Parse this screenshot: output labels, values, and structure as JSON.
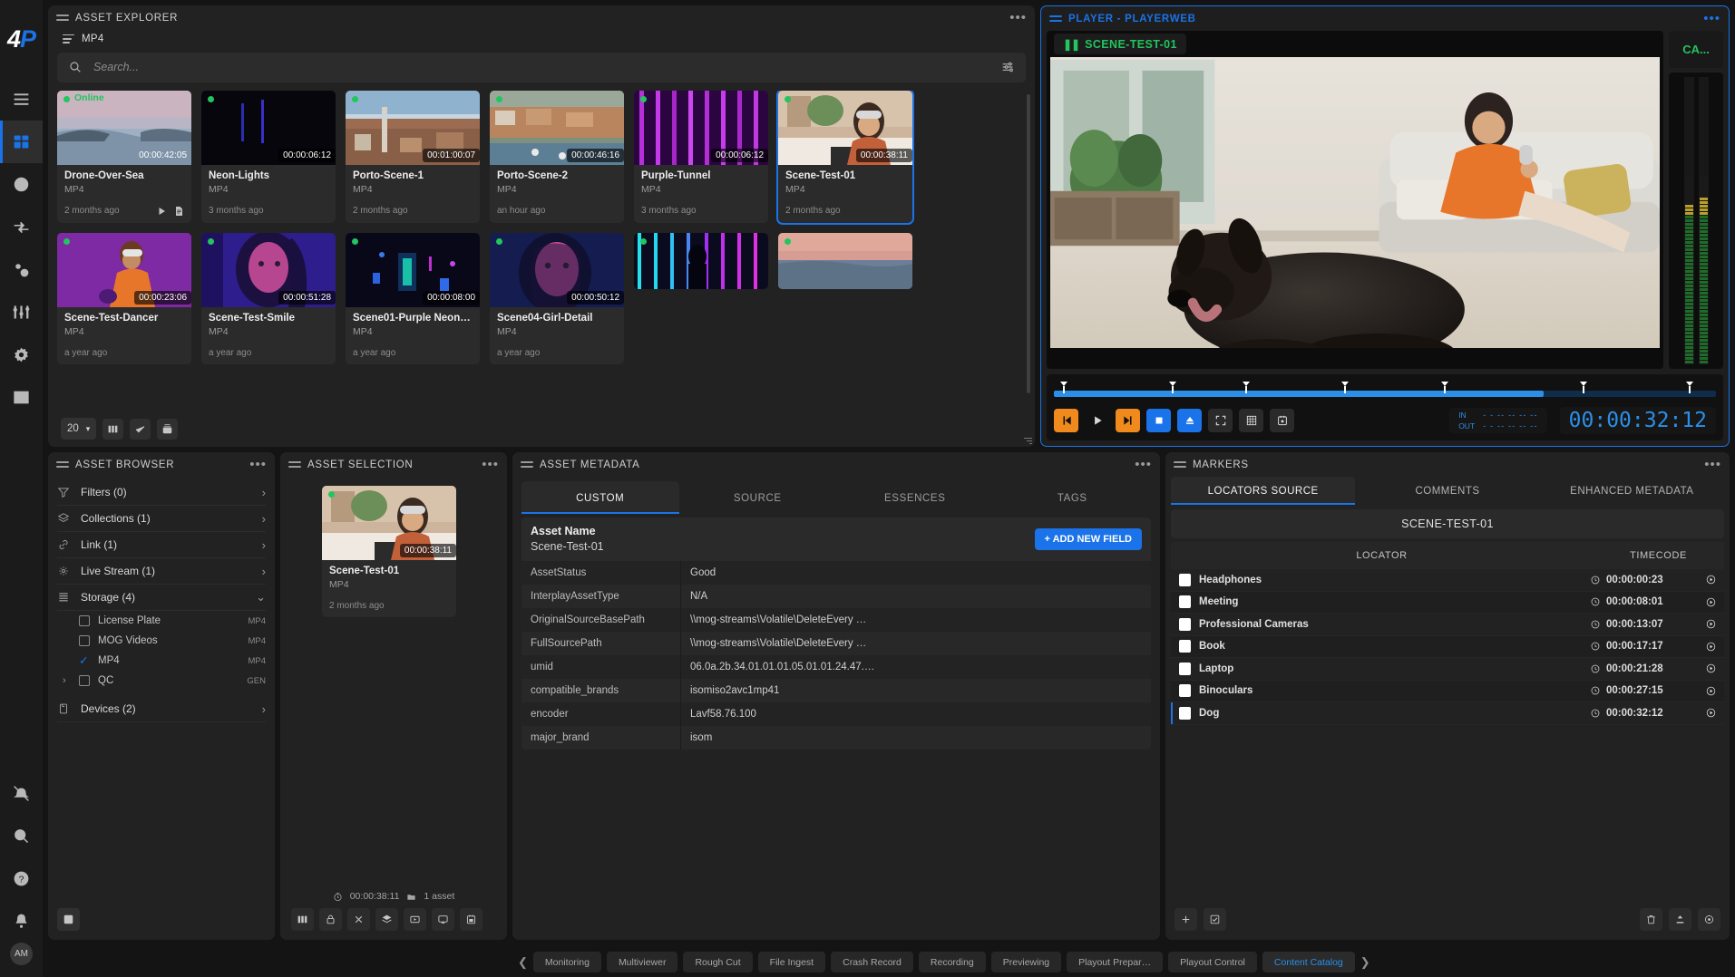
{
  "rail": {
    "logo": {
      "w": "4",
      "b": "P"
    },
    "items": [
      {
        "name": "menu",
        "icon": "hamburger-icon"
      },
      {
        "name": "dashboard",
        "icon": "dashboard-icon",
        "active": true
      },
      {
        "name": "history",
        "icon": "clock-icon"
      },
      {
        "name": "transfer",
        "icon": "transfer-icon"
      },
      {
        "name": "workflow",
        "icon": "gears-icon"
      },
      {
        "name": "mixer",
        "icon": "faders-icon"
      },
      {
        "name": "settings",
        "icon": "gear-icon"
      },
      {
        "name": "grid",
        "icon": "table-grid-icon"
      }
    ],
    "bottom_items": [
      {
        "name": "mute",
        "icon": "no-bell-icon"
      },
      {
        "name": "search",
        "icon": "search-icon"
      },
      {
        "name": "help",
        "icon": "question-icon"
      },
      {
        "name": "notifications",
        "icon": "bell-icon"
      }
    ],
    "avatar": "AM"
  },
  "explorer": {
    "title": "ASSET EXPLORER",
    "breadcrumb": "MP4",
    "search_placeholder": "Search...",
    "page_size": "20",
    "assets": [
      {
        "name": "Drone-Over-Sea",
        "format": "MP4",
        "age": "2 months ago",
        "tc": "00:00:42:05",
        "tc_plain": true,
        "online_label": "Online",
        "has_actions": true,
        "thumb": "sea-sunset"
      },
      {
        "name": "Neon-Lights",
        "format": "MP4",
        "age": "3 months ago",
        "tc": "00:00:06:12",
        "thumb": "neon-dark"
      },
      {
        "name": "Porto-Scene-1",
        "format": "MP4",
        "age": "2 months ago",
        "tc": "00:01:00:07",
        "thumb": "porto-city"
      },
      {
        "name": "Porto-Scene-2",
        "format": "MP4",
        "age": "an hour ago",
        "tc": "00:00:46:16",
        "thumb": "porto-aerial"
      },
      {
        "name": "Purple-Tunnel",
        "format": "MP4",
        "age": "3 months ago",
        "tc": "00:00:06:12",
        "thumb": "purple-tunnel"
      },
      {
        "name": "Scene-Test-01",
        "format": "MP4",
        "age": "2 months ago",
        "tc": "00:00:38:11",
        "selected": true,
        "thumb": "woman-cafe"
      },
      {
        "name": "Scene-Test-Dancer",
        "format": "MP4",
        "age": "a year ago",
        "tc": "00:00:23:06",
        "thumb": "dancer-purple"
      },
      {
        "name": "Scene-Test-Smile",
        "format": "MP4",
        "age": "a year ago",
        "tc": "00:00:51:28",
        "thumb": "portrait-blue"
      },
      {
        "name": "Scene01-Purple Neon Tu…",
        "format": "MP4",
        "age": "a year ago",
        "tc": "00:00:08:00",
        "thumb": "club-neon"
      },
      {
        "name": "Scene04-Girl-Detail",
        "format": "MP4",
        "age": "a year ago",
        "tc": "00:00:50:12",
        "thumb": "girl-blue"
      },
      {
        "name": "",
        "format": "",
        "age": "",
        "tc": "",
        "thumb": "neon-bars"
      },
      {
        "name": "",
        "format": "",
        "age": "",
        "tc": "",
        "thumb": "sunset-sea"
      }
    ]
  },
  "player": {
    "title": "PLAYER - PLAYERWEB",
    "clip_name": "SCENE-TEST-01",
    "camera_button": "CA...",
    "in_label": "IN",
    "out_label": "OUT",
    "in_value": "- - -- -- -- --",
    "out_value": "- - -- -- -- --",
    "timecode": "00:00:32:12",
    "transport": [
      {
        "name": "jump-start-button",
        "icon": "skip-back-icon",
        "style": "orange"
      },
      {
        "name": "play-button",
        "icon": "play-icon",
        "style": "ghost"
      },
      {
        "name": "jump-end-button",
        "icon": "skip-fwd-icon",
        "style": "orange"
      },
      {
        "name": "stop-button",
        "icon": "stop-icon",
        "style": "blue"
      },
      {
        "name": "eject-button",
        "icon": "eject-icon",
        "style": "blue"
      },
      {
        "name": "fullscreen-button",
        "icon": "fullscreen-icon",
        "style": "dark"
      },
      {
        "name": "grid-button",
        "icon": "grid-icon",
        "style": "dark"
      },
      {
        "name": "calendar-button",
        "icon": "calendar-icon",
        "style": "dark"
      }
    ],
    "marker_positions": [
      1.5,
      18,
      29,
      44,
      59,
      80,
      96
    ]
  },
  "browser": {
    "title": "ASSET BROWSER",
    "rows": [
      {
        "label": "Filters (0)",
        "icon": "filter-icon",
        "chev": "›"
      },
      {
        "label": "Collections (1)",
        "icon": "layers-icon",
        "chev": "›"
      },
      {
        "label": "Link (1)",
        "icon": "link-icon",
        "chev": "›"
      },
      {
        "label": "Live Stream (1)",
        "icon": "live-icon",
        "chev": "›"
      },
      {
        "label": "Storage (4)",
        "icon": "storage-icon",
        "chev": "⌄",
        "expanded": true
      }
    ],
    "storage_items": [
      {
        "label": "License Plate",
        "tag": "MP4",
        "checked": false
      },
      {
        "label": "MOG Videos",
        "tag": "MP4",
        "checked": false
      },
      {
        "label": "MP4",
        "tag": "MP4",
        "checked": true
      },
      {
        "label": "QC",
        "tag": "GEN",
        "checked": false,
        "expandable": true
      }
    ],
    "devices_row": {
      "label": "Devices (2)",
      "icon": "device-icon",
      "chev": "›"
    },
    "foot_button": "add-panel-button"
  },
  "selection": {
    "title": "ASSET SELECTION",
    "card": {
      "name": "Scene-Test-01",
      "format": "MP4",
      "age": "2 months ago",
      "tc": "00:00:38:11"
    },
    "duration": "00:00:38:11",
    "count": "1 asset",
    "toolbar": [
      {
        "name": "columns-button",
        "icon": "columns-icon"
      },
      {
        "name": "lock-button",
        "icon": "lock-icon"
      },
      {
        "name": "clear-button",
        "icon": "close-icon"
      },
      {
        "name": "layers-button",
        "icon": "layers-icon"
      },
      {
        "name": "player-button",
        "icon": "player-icon"
      },
      {
        "name": "cast-button",
        "icon": "cast-icon"
      },
      {
        "name": "calendar-button",
        "icon": "calendar-icon"
      }
    ]
  },
  "metadata": {
    "title": "ASSET METADATA",
    "tabs": [
      {
        "label": "CUSTOM",
        "active": true
      },
      {
        "label": "SOURCE",
        "active": false
      },
      {
        "label": "ESSENCES",
        "active": false
      },
      {
        "label": "TAGS",
        "active": false
      }
    ],
    "asset_name_label": "Asset Name",
    "asset_name_value": "Scene-Test-01",
    "add_field_label": "+ ADD NEW FIELD",
    "fields": [
      {
        "key": "AssetStatus",
        "value": "Good"
      },
      {
        "key": "InterplayAssetType",
        "value": "N/A"
      },
      {
        "key": "OriginalSourceBasePath",
        "value": "\\\\mog-streams\\Volatile\\DeleteEvery …"
      },
      {
        "key": "FullSourcePath",
        "value": "\\\\mog-streams\\Volatile\\DeleteEvery …"
      },
      {
        "key": "umid",
        "value": "06.0a.2b.34.01.01.01.05.01.01.24.47.…"
      },
      {
        "key": "compatible_brands",
        "value": "isomiso2avc1mp41"
      },
      {
        "key": "encoder",
        "value": "Lavf58.76.100"
      },
      {
        "key": "major_brand",
        "value": "isom"
      }
    ]
  },
  "markers": {
    "title": "MARKERS",
    "tabs": [
      {
        "label": "LOCATORS SOURCE",
        "active": true
      },
      {
        "label": "COMMENTS",
        "active": false
      },
      {
        "label": "ENHANCED METADATA",
        "active": false
      }
    ],
    "asset": "SCENE-TEST-01",
    "columns": {
      "locator": "LOCATOR",
      "timecode": "TIMECODE"
    },
    "rows": [
      {
        "name": "Headphones",
        "tc": "00:00:00:23"
      },
      {
        "name": "Meeting",
        "tc": "00:00:08:01"
      },
      {
        "name": "Professional Cameras",
        "tc": "00:00:13:07"
      },
      {
        "name": "Book",
        "tc": "00:00:17:17"
      },
      {
        "name": "Laptop",
        "tc": "00:00:21:28"
      },
      {
        "name": "Binoculars",
        "tc": "00:00:27:15"
      },
      {
        "name": "Dog",
        "tc": "00:00:32:12",
        "active": true
      }
    ],
    "foot_left": [
      {
        "name": "add-marker-button",
        "icon": "plus-icon"
      },
      {
        "name": "select-all-button",
        "icon": "check-box-icon"
      }
    ],
    "foot_right": [
      {
        "name": "delete-button",
        "icon": "trash-icon"
      },
      {
        "name": "export-button",
        "icon": "export-icon"
      },
      {
        "name": "settings-button",
        "icon": "settings-icon"
      }
    ]
  },
  "taskbar": {
    "prev": "❮",
    "next": "❯",
    "items": [
      {
        "label": "Monitoring",
        "active": false
      },
      {
        "label": "Multiviewer",
        "active": false
      },
      {
        "label": "Rough Cut",
        "active": false
      },
      {
        "label": "File Ingest",
        "active": false
      },
      {
        "label": "Crash Record",
        "active": false
      },
      {
        "label": "Recording",
        "active": false
      },
      {
        "label": "Previewing",
        "active": false
      },
      {
        "label": "Playout Prepar…",
        "active": false
      },
      {
        "label": "Playout Control",
        "active": false
      },
      {
        "label": "Content Catalog",
        "active": true
      }
    ]
  },
  "colors": {
    "accent": "#1a73e8",
    "orange": "#f08a1d",
    "green": "#22c55e",
    "panel": "#222222",
    "bg": "#141414"
  }
}
